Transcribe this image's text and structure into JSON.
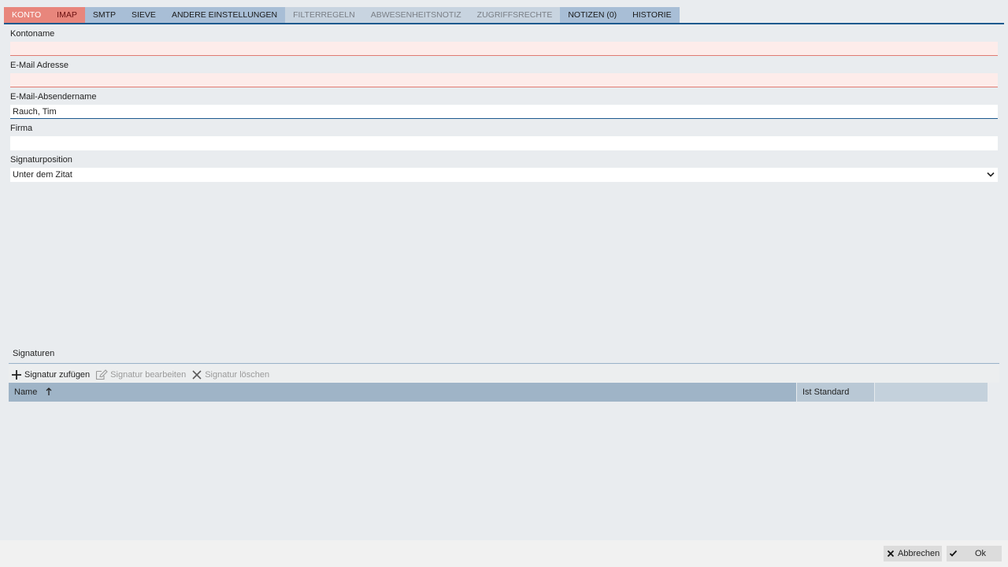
{
  "tabs": [
    {
      "label": "Konto",
      "state": "active"
    },
    {
      "label": "IMAP",
      "state": "error"
    },
    {
      "label": "SMTP",
      "state": "normal"
    },
    {
      "label": "Sieve",
      "state": "normal"
    },
    {
      "label": "Andere Einstellungen",
      "state": "normal"
    },
    {
      "label": "Filterregeln",
      "state": "disabled"
    },
    {
      "label": "Abwesenheitsnotiz",
      "state": "disabled"
    },
    {
      "label": "Zugriffsrechte",
      "state": "disabled"
    },
    {
      "label": "Notizen (0)",
      "state": "normal"
    },
    {
      "label": "Historie",
      "state": "normal"
    }
  ],
  "form": {
    "account_name_label": "Kontoname",
    "account_name_value": "",
    "email_label": "E-Mail Adresse",
    "email_value": "",
    "sender_name_label": "E-Mail-Absendername",
    "sender_name_value": "Rauch, Tim",
    "company_label": "Firma",
    "company_value": "",
    "signature_position_label": "Signaturposition",
    "signature_position_value": "Unter dem Zitat"
  },
  "signatures": {
    "title": "Signaturen",
    "add_label": "Signatur zufügen",
    "edit_label": "Signatur bearbeiten",
    "delete_label": "Signatur löschen",
    "col_name": "Name",
    "col_default": "Ist Standard"
  },
  "footer": {
    "cancel_label": "Abbrechen",
    "ok_label": "Ok"
  },
  "colors": {
    "accent": "#1d5a8f",
    "tab_active": "#e8867c",
    "tab_normal": "#a8bed6",
    "invalid_bg": "#fdecea"
  }
}
